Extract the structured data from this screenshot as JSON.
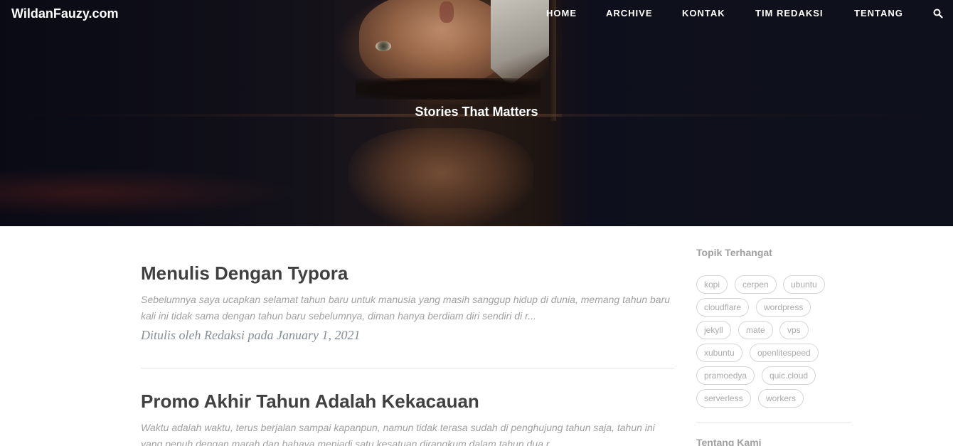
{
  "site": {
    "brand": "WildanFauzy.com",
    "tagline": "Stories That Matters"
  },
  "nav": {
    "items": [
      {
        "label": "HOME"
      },
      {
        "label": "ARCHIVE"
      },
      {
        "label": "KONTAK"
      },
      {
        "label": "TIM REDAKSI"
      },
      {
        "label": "TENTANG"
      }
    ],
    "search_icon": "search-icon"
  },
  "posts": [
    {
      "title": "Menulis Dengan Typora",
      "excerpt": "Sebelumnya saya ucapkan selamat tahun baru untuk manusia yang masih sanggup hidup di dunia, memang tahun baru kali ini tidak sama dengan tahun baru sebelumnya, diman hanya berdiam diri sendiri di r...",
      "meta": "Ditulis oleh Redaksi pada January 1, 2021"
    },
    {
      "title": "Promo Akhir Tahun Adalah Kekacauan",
      "excerpt": "Waktu adalah waktu, terus berjalan sampai kapanpun, namun tidak terasa sudah di penghujung tahun saja, tahun ini yang penuh dengan marah dan bahaya menjadi satu kesatuan dirangkum dalam tahun dua r..."
    }
  ],
  "sidebar": {
    "topics_title": "Topik Terhangat",
    "tags": [
      "kopi",
      "cerpen",
      "ubuntu",
      "cloudflare",
      "wordpress",
      "jekyll",
      "mate",
      "vps",
      "xubuntu",
      "openlitespeed",
      "pramoedya",
      "quic.cloud",
      "serverless",
      "workers"
    ],
    "about_title": "Tentang Kami"
  }
}
